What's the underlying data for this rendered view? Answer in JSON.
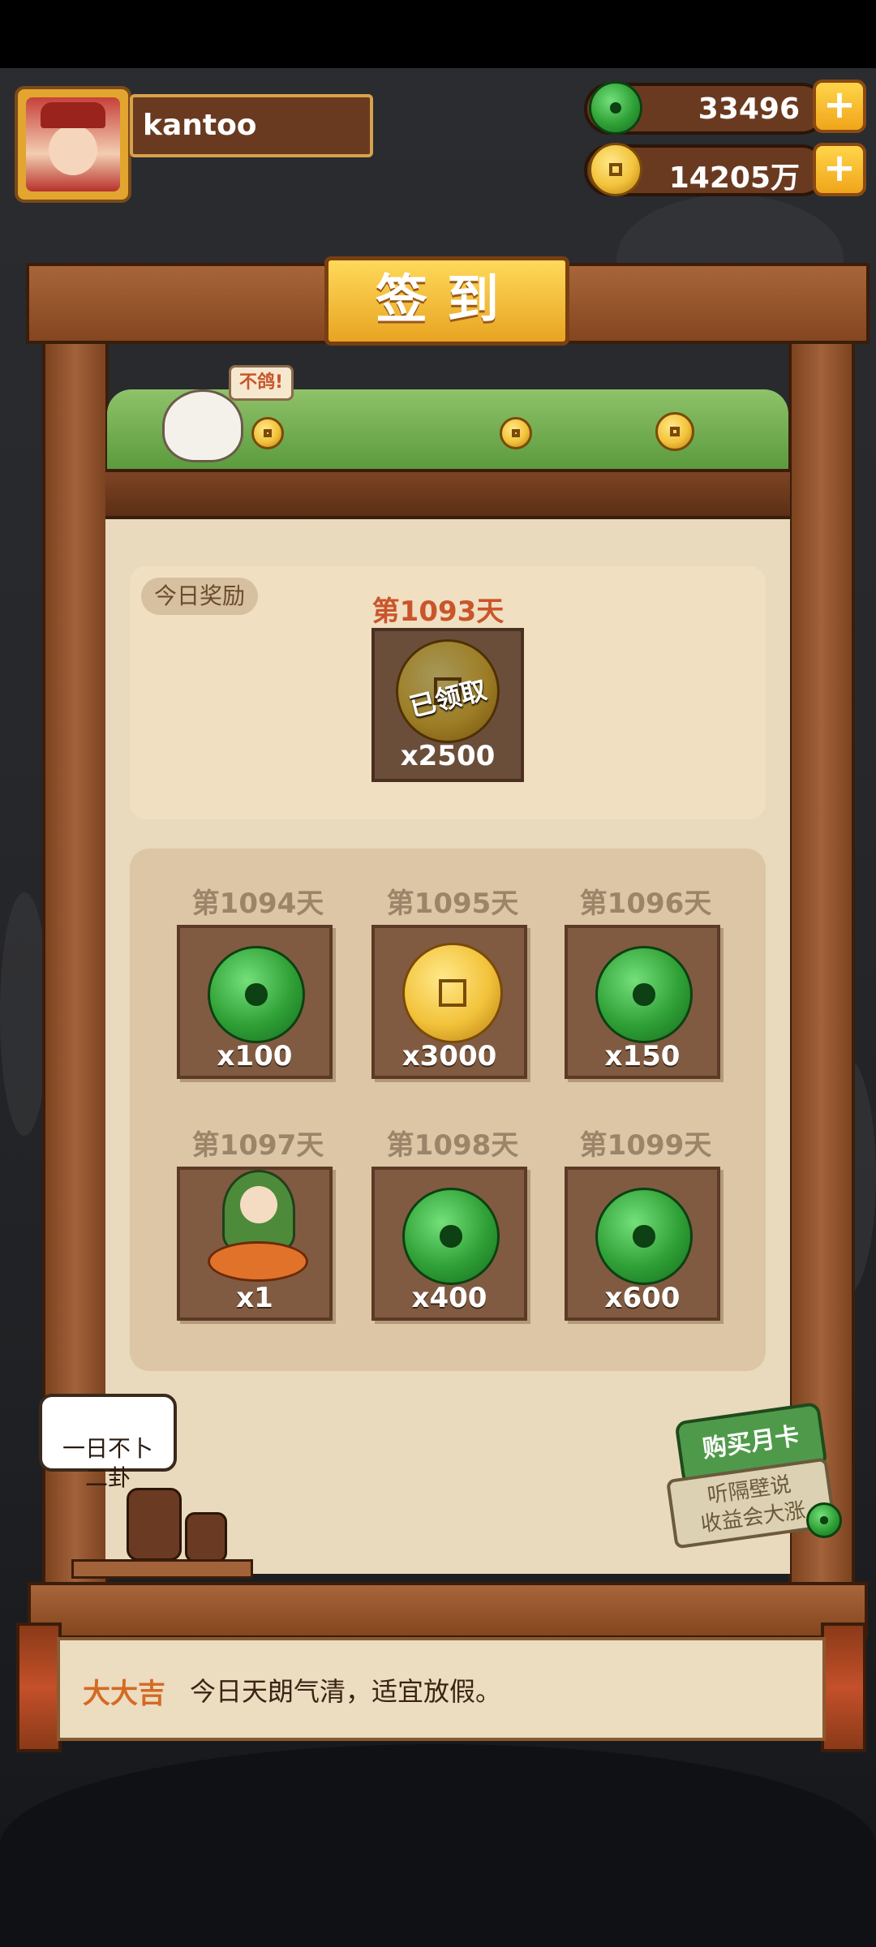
{
  "player": {
    "name": "kantoo"
  },
  "resources": {
    "jade": {
      "value": "33496",
      "icon": "jade-coin-icon"
    },
    "gold": {
      "value": "14205万",
      "icon": "gold-coin-icon"
    }
  },
  "title": "签到",
  "bird_bubble": "不鸽!",
  "today": {
    "tag": "今日奖励",
    "day": "第1093天",
    "status": "已领取",
    "qty": "x2500",
    "icon": "gold-coin-icon"
  },
  "rewards": [
    {
      "day": "第1094天",
      "qty": "x100",
      "icon": "jade-coin-icon"
    },
    {
      "day": "第1095天",
      "qty": "x3000",
      "icon": "gold-coin-icon"
    },
    {
      "day": "第1096天",
      "qty": "x150",
      "icon": "jade-coin-icon"
    },
    {
      "day": "第1097天",
      "qty": "x1",
      "icon": "fortune-deity-icon"
    },
    {
      "day": "第1098天",
      "qty": "x400",
      "icon": "jade-coin-icon"
    },
    {
      "day": "第1099天",
      "qty": "x600",
      "icon": "jade-coin-icon"
    }
  ],
  "speech": "一日不卜\n二卦",
  "month_card": {
    "title": "购买月卡",
    "subtitle": "听隔壁说\n收益会大涨"
  },
  "fortune": {
    "level": "大大吉",
    "text": "今日天朗气清，适宜放假。"
  },
  "colors": {
    "accent": "#c9552b",
    "wood": "#84461f",
    "jade": "#2fa036",
    "gold": "#f2c23a"
  }
}
